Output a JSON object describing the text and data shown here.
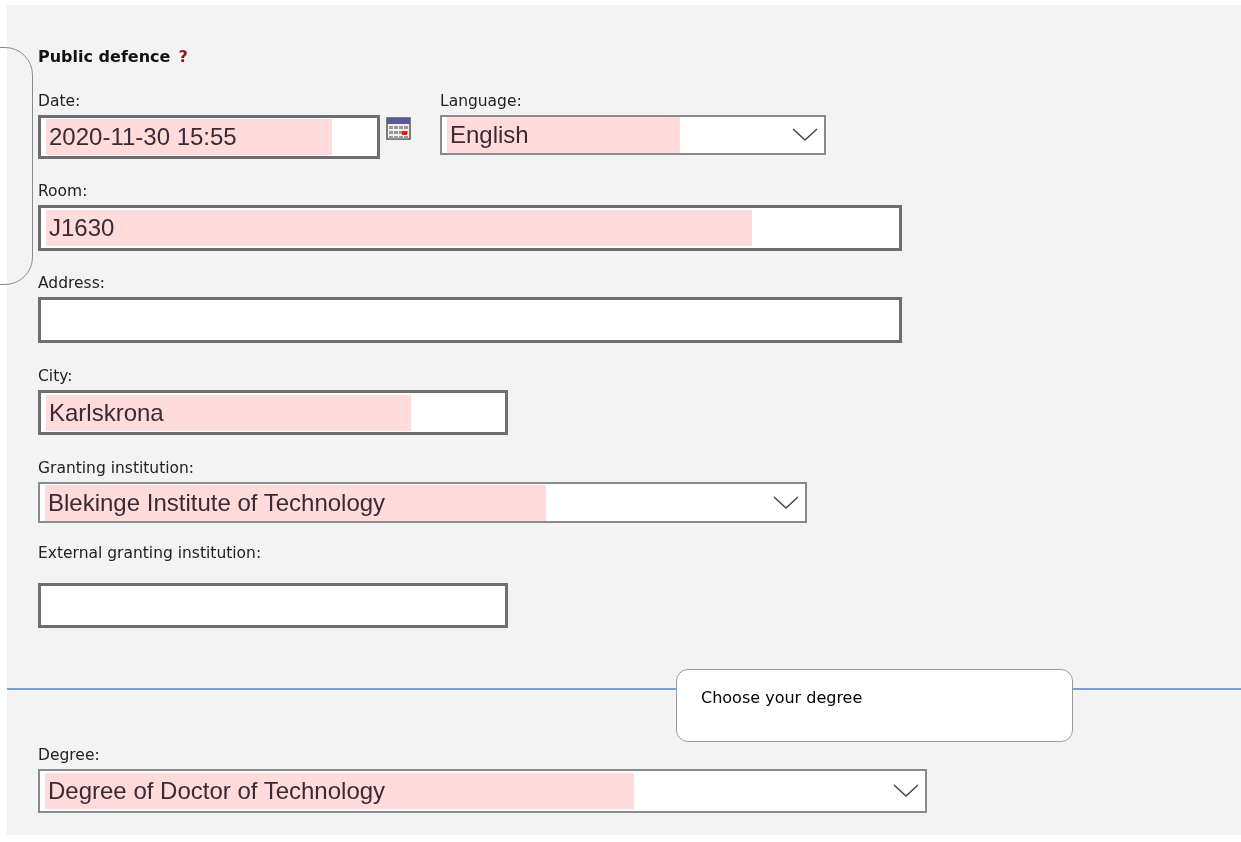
{
  "section": {
    "title": "Public defence",
    "help": "?"
  },
  "date_row": [
    {
      "kind": "date",
      "label": "Date:",
      "value": "2020-11-30 15:55",
      "highlighted": true
    },
    {
      "kind": "select",
      "label": "Language:",
      "value": "English",
      "highlighted": true
    }
  ],
  "fields": [
    {
      "kind": "text",
      "label": "Room:",
      "value": "J1630",
      "highlighted": true
    },
    {
      "kind": "text",
      "label": "Address:"
    },
    {
      "kind": "text",
      "label": "City:",
      "value": "Karlskrona",
      "highlighted": true
    },
    {
      "kind": "select",
      "label": "Granting institution:",
      "value": "Blekinge Institute of Technology",
      "highlighted": true
    },
    {
      "kind": "text",
      "label": "External granting institution:"
    }
  ],
  "callout": {
    "text": "Choose your degree"
  },
  "degree": {
    "kind": "select",
    "label": "Degree:",
    "value": "Degree of Doctor of Technology",
    "highlighted": true
  }
}
